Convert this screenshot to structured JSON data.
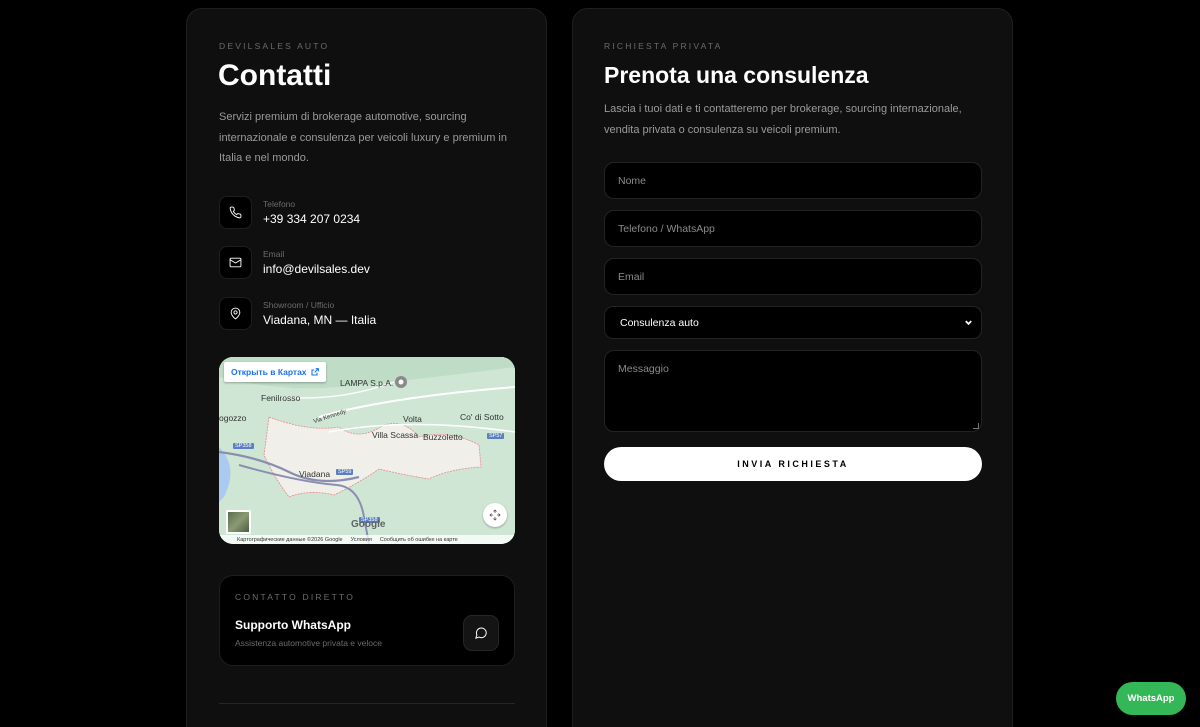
{
  "contacts": {
    "eyebrow": "DEVILSALES AUTO",
    "title": "Contatti",
    "description": "Servizi premium di brokerage automotive, sourcing internazionale e consulenza per veicoli luxury e premium in Italia e nel mondo.",
    "items": [
      {
        "icon": "phone-icon",
        "label": "Telefono",
        "value": "+39 334 207 0234"
      },
      {
        "icon": "mail-icon",
        "label": "Email",
        "value": "info@devilsales.dev"
      },
      {
        "icon": "map-pin-icon",
        "label": "Showroom / Ufficio",
        "value": "Viadana, MN — Italia"
      }
    ]
  },
  "map": {
    "open_label": "Открыть в Картах",
    "places": [
      "LAMPA S.p.A.",
      "Fenilrosso",
      "ogozzo",
      "Volta",
      "Co' di Sotto",
      "Villa Scassa",
      "Buzzoletto",
      "Viadana",
      "Via Kennedy"
    ],
    "roads": [
      "SP358",
      "SP59",
      "SP57",
      "SP358"
    ],
    "google": "Google",
    "footer": [
      "Картографические данные ©2026 Google",
      "Условия",
      "Сообщить об ошибке на карте"
    ]
  },
  "whatsapp_card": {
    "eyebrow": "CONTATTO DIRETTO",
    "title": "Supporto WhatsApp",
    "subtitle": "Assistenza automotive privata e veloce"
  },
  "form": {
    "eyebrow": "RICHIESTA PRIVATA",
    "title": "Prenota una consulenza",
    "description": "Lascia i tuoi dati e ti contatteremo per brokerage, sourcing internazionale, vendita privata o consulenza su veicoli premium.",
    "name_placeholder": "Nome",
    "phone_placeholder": "Telefono / WhatsApp",
    "email_placeholder": "Email",
    "select_value": "Consulenza auto",
    "message_placeholder": "Messaggio",
    "submit_label": "INVIA RICHIESTA"
  },
  "floating_button": {
    "label": "WhatsApp",
    "color": "#34b857"
  }
}
